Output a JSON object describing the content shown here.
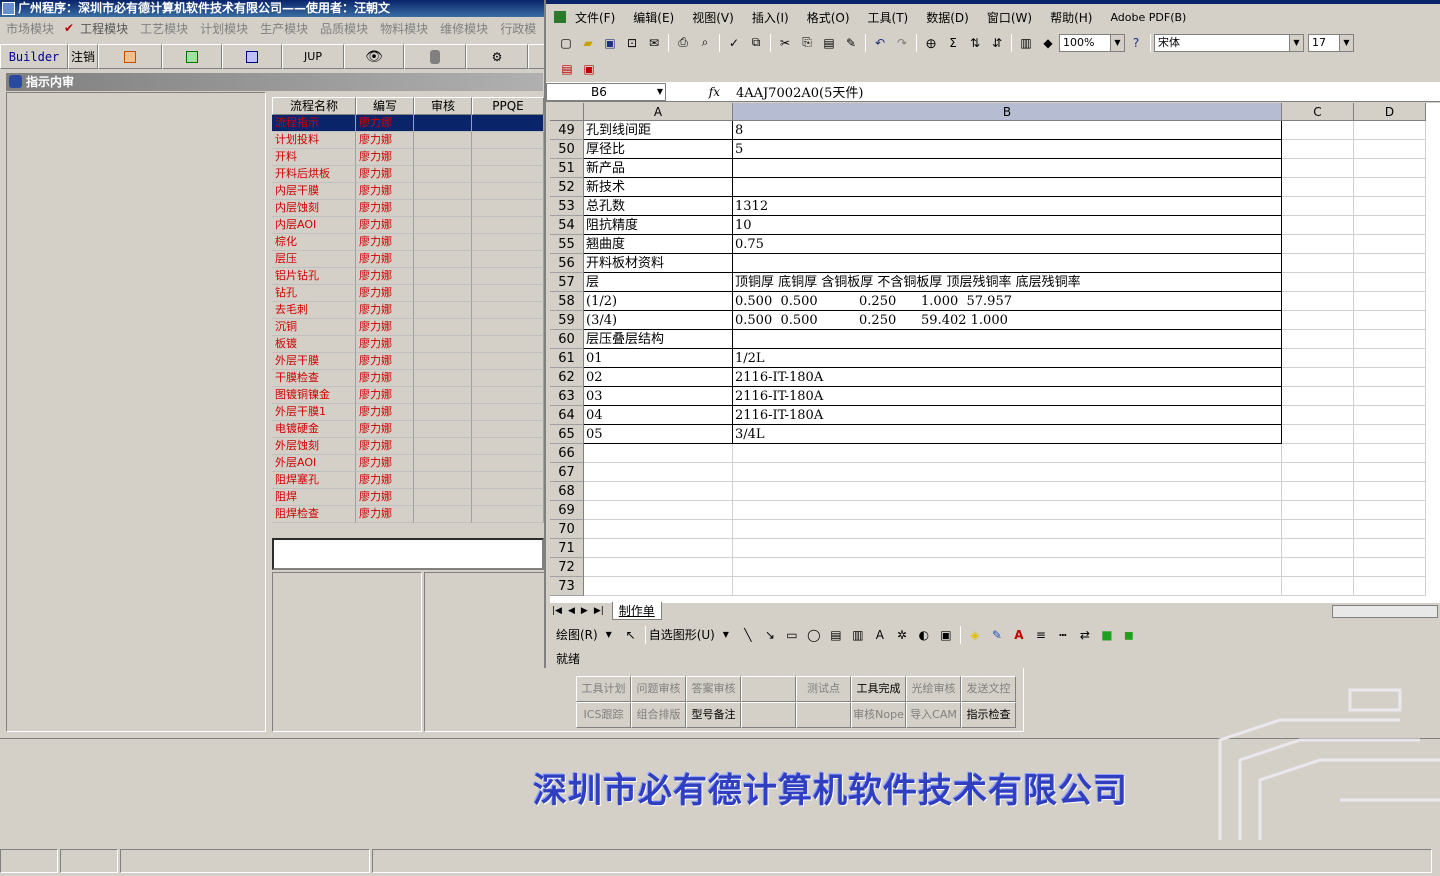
{
  "app": {
    "title": "广州程序：深圳市必有德计算机软件技术有限公司——使用者：汪朝文",
    "modules": [
      "市场模块",
      "工程模块",
      "工艺模块",
      "计划模块",
      "生产模块",
      "品质模块",
      "物料模块",
      "维修模块",
      "行政模"
    ],
    "toolbar": {
      "builder": "Builder",
      "logout": "注销",
      "jup": "JUP"
    },
    "window_title": "指示内审",
    "flow_table": {
      "headers": [
        "流程名称",
        "编写",
        "审核",
        "PPQE"
      ],
      "rows": [
        [
          "流程指示",
          "廖力娜"
        ],
        [
          "计划投料",
          "廖力娜"
        ],
        [
          "开料",
          "廖力娜"
        ],
        [
          "开料后烘板",
          "廖力娜"
        ],
        [
          "内层干膜",
          "廖力娜"
        ],
        [
          "内层蚀刻",
          "廖力娜"
        ],
        [
          "内层AOI",
          "廖力娜"
        ],
        [
          "棕化",
          "廖力娜"
        ],
        [
          "层压",
          "廖力娜"
        ],
        [
          "铝片钻孔",
          "廖力娜"
        ],
        [
          "钻孔",
          "廖力娜"
        ],
        [
          "去毛刺",
          "廖力娜"
        ],
        [
          "沉铜",
          "廖力娜"
        ],
        [
          "板镀",
          "廖力娜"
        ],
        [
          "外层干膜",
          "廖力娜"
        ],
        [
          "干膜检查",
          "廖力娜"
        ],
        [
          "图镀铜镍金",
          "廖力娜"
        ],
        [
          "外层干膜1",
          "廖力娜"
        ],
        [
          "电镀硬金",
          "廖力娜"
        ],
        [
          "外层蚀刻",
          "廖力娜"
        ],
        [
          "外层AOI",
          "廖力娜"
        ],
        [
          "阻焊塞孔",
          "廖力娜"
        ],
        [
          "阻焊",
          "廖力娜"
        ],
        [
          "阻焊检查",
          "廖力娜"
        ]
      ]
    },
    "buttons_row1": [
      "工具计划",
      "问题审核",
      "答案审核",
      "",
      "测试点",
      "工具完成",
      "光绘审核",
      "发送文控"
    ],
    "buttons_row2": [
      "ICS跟踪",
      "组合排版",
      "型号备注",
      "",
      "",
      "审核Nope",
      "导入CAM",
      "指示检查"
    ],
    "company": "深圳市必有德计算机软件技术有限公司"
  },
  "excel": {
    "menu": [
      "文件(F)",
      "编辑(E)",
      "视图(V)",
      "插入(I)",
      "格式(O)",
      "工具(T)",
      "数据(D)",
      "窗口(W)",
      "帮助(H)",
      "Adobe PDF(B)"
    ],
    "zoom": "100%",
    "font": "宋体",
    "font_size": "17",
    "name_box": "B6",
    "formula": "4AAJ7002A0(5天件)",
    "columns": [
      "A",
      "B",
      "C",
      "D"
    ],
    "rows": [
      {
        "n": "49",
        "a": "孔到线间距",
        "b": "8"
      },
      {
        "n": "50",
        "a": "厚径比",
        "b": "5"
      },
      {
        "n": "51",
        "a": "新产品",
        "b": ""
      },
      {
        "n": "52",
        "a": "新技术",
        "b": ""
      },
      {
        "n": "53",
        "a": "总孔数",
        "b": "1312"
      },
      {
        "n": "54",
        "a": "阻抗精度",
        "b": "10"
      },
      {
        "n": "55",
        "a": "翘曲度",
        "b": "0.75"
      },
      {
        "n": "56",
        "a": "开料板材资料",
        "b": ""
      },
      {
        "n": "57",
        "a": "层",
        "b": "顶铜厚 底铜厚 含铜板厚 不含铜板厚 顶层残铜率 底层残铜率"
      },
      {
        "n": "58",
        "a": "(1/2)",
        "b": "0.500  0.500          0.250      1.000  57.957"
      },
      {
        "n": "59",
        "a": "(3/4)",
        "b": "0.500  0.500          0.250      59.402 1.000"
      },
      {
        "n": "60",
        "a": "层压叠层结构",
        "b": ""
      },
      {
        "n": "61",
        "a": "01",
        "b": "1/2L"
      },
      {
        "n": "62",
        "a": "02",
        "b": "2116-IT-180A"
      },
      {
        "n": "63",
        "a": "03",
        "b": "2116-IT-180A"
      },
      {
        "n": "64",
        "a": "04",
        "b": "2116-IT-180A"
      },
      {
        "n": "65",
        "a": "05",
        "b": "3/4L"
      },
      {
        "n": "66",
        "a": "",
        "b": ""
      },
      {
        "n": "67",
        "a": "",
        "b": ""
      },
      {
        "n": "68",
        "a": "",
        "b": ""
      },
      {
        "n": "69",
        "a": "",
        "b": ""
      },
      {
        "n": "70",
        "a": "",
        "b": ""
      },
      {
        "n": "71",
        "a": "",
        "b": ""
      },
      {
        "n": "72",
        "a": "",
        "b": ""
      },
      {
        "n": "73",
        "a": "",
        "b": ""
      }
    ],
    "sheet_tab": "制作单",
    "draw_label": "绘图(R)",
    "autoshape_label": "自选图形(U)",
    "status": "就绪"
  }
}
